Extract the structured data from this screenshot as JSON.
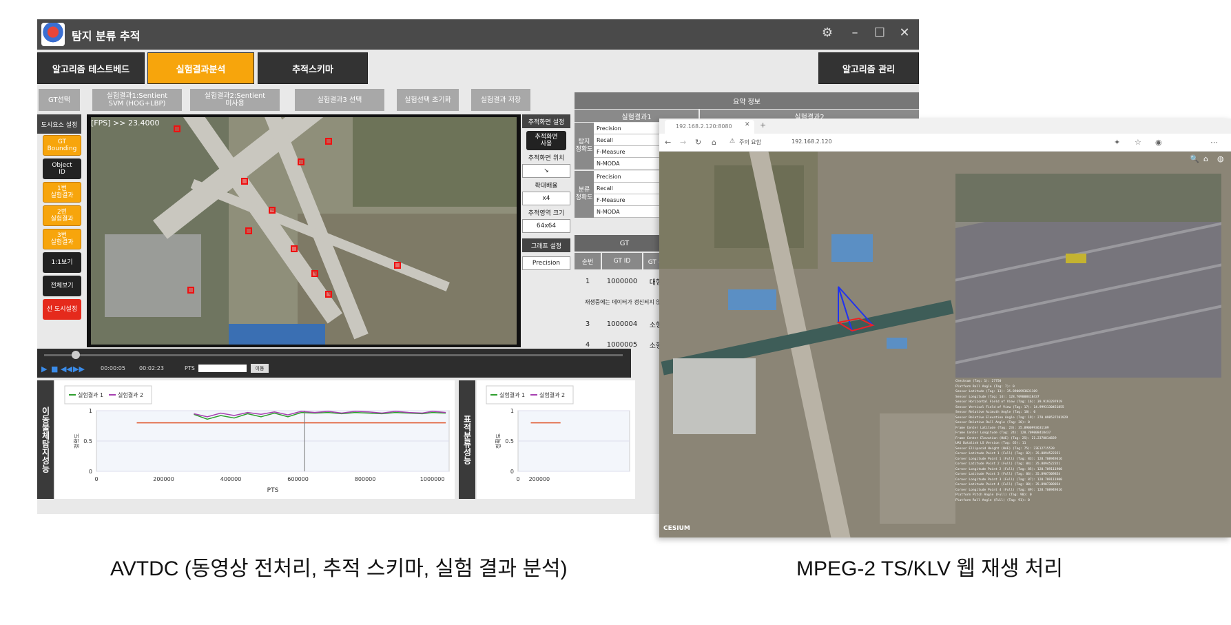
{
  "app": {
    "title": "탐지 분류 추적",
    "nav": {
      "testbed": "알고리즘 테스트베드",
      "analysis": "실험결과분석",
      "schema": "추적스키마",
      "manage": "알고리즘 관리"
    },
    "toolbar": {
      "gt_select": "GT선택",
      "result1": "실험결과1:Sentient\nSVM (HOG+LBP)",
      "result2": "실험결과2:Sentient\n미사용",
      "result3": "실험결과3 선택",
      "reset": "실험선택 초기화",
      "save": "실험결과 저장"
    },
    "display_settings": {
      "header": "도시요소 설정",
      "buttons": [
        "GT\nBounding",
        "Object\nID",
        "1번\n실험결과",
        "2번\n실험결과",
        "3번\n실험결과",
        "1:1보기",
        "전체보기",
        "선 도시설정"
      ]
    },
    "video": {
      "overlay": "[FPS] >> 23.4000"
    },
    "track_settings": {
      "header": "추적화면 설정",
      "use_label": "추적화면\n사용",
      "position_label": "추적화면 위치",
      "position_value": "↘",
      "zoom_label": "확대배율",
      "zoom_value": "x4",
      "area_label": "추적영역 크기",
      "area_value": "64x64",
      "graph_header": "그래프 설정",
      "graph_value": "Precision"
    },
    "summary": {
      "header": "요약 정보",
      "result1_col": "실험결과1",
      "result2_col": "실험결과2",
      "detect_group": "탐지\n정확도",
      "classify_group": "분류\n정확도",
      "metrics": [
        "Precision",
        "Recall",
        "F-Measure",
        "N-MODA"
      ]
    },
    "gt_table": {
      "header": "GT",
      "columns": [
        "순번",
        "GT ID",
        "GT 분류"
      ],
      "rows": [
        {
          "idx": "1",
          "id": "1000000",
          "cls": "대형차"
        },
        {
          "idx": "재생중에는 데이터가 갱신되지 않음",
          "id": "",
          "cls": ""
        },
        {
          "idx": "3",
          "id": "1000004",
          "cls": "소형차"
        },
        {
          "idx": "4",
          "id": "1000005",
          "cls": "소형차"
        }
      ]
    },
    "timeline": {
      "elapsed": "00:00:05",
      "total": "00:02:23",
      "pts_label": "PTS",
      "move_button": "이동"
    },
    "chart_labels": {
      "left": "이동물체탐지성능",
      "right": "표적분류성능"
    }
  },
  "chart_data": [
    {
      "type": "line",
      "xlabel": "PTS",
      "ylabel": "정확도",
      "xlim": [
        0,
        1050000
      ],
      "ylim": [
        0,
        1
      ],
      "xticks": [
        "0",
        "200000",
        "400000",
        "600000",
        "800000",
        "1000000"
      ],
      "yticks": [
        "0",
        "0.5",
        "1"
      ],
      "legend_position": "top-left",
      "grid": true,
      "x": [
        120000,
        290000,
        330000,
        370000,
        410000,
        450000,
        490000,
        530000,
        570000,
        610000,
        650000,
        690000,
        730000,
        770000,
        810000,
        850000,
        890000,
        930000,
        970000,
        1000000,
        1040000
      ],
      "series": [
        {
          "name": "실험결과 1",
          "color": "#2e9e2e",
          "values": [
            null,
            0.94,
            0.86,
            0.92,
            0.88,
            0.95,
            0.9,
            0.96,
            0.9,
            0.97,
            0.96,
            0.97,
            0.95,
            0.97,
            0.96,
            0.95,
            0.97,
            0.96,
            0.95,
            0.97,
            0.96
          ]
        },
        {
          "name": "실험결과 2",
          "color": "#a63fb0",
          "values": [
            null,
            0.95,
            0.9,
            0.96,
            0.92,
            0.97,
            0.94,
            0.98,
            0.93,
            0.99,
            0.97,
            0.99,
            0.96,
            0.99,
            0.98,
            0.96,
            0.99,
            0.97,
            0.96,
            0.99,
            0.97
          ]
        },
        {
          "name": "",
          "color": "#e0552b",
          "values": [
            0.8,
            0.8,
            0.8,
            0.8,
            0.8,
            0.8,
            0.8,
            0.8,
            0.8,
            0.8,
            0.8,
            0.8,
            0.8,
            0.8,
            0.8,
            0.8,
            0.8,
            0.8,
            0.8,
            0.8,
            0.8
          ]
        }
      ],
      "marker_x": 620000
    },
    {
      "type": "line",
      "ylabel": "정확도",
      "xlim": [
        0,
        1050000
      ],
      "ylim": [
        0,
        1
      ],
      "xticks": [
        "0",
        "200000"
      ],
      "yticks": [
        "0",
        "0.5",
        "1"
      ],
      "legend_position": "top-left",
      "grid": true,
      "x": [
        120000,
        400000
      ],
      "series": [
        {
          "name": "실험결과 1",
          "color": "#2e9e2e",
          "values": []
        },
        {
          "name": "실험결과 2",
          "color": "#a63fb0",
          "values": []
        },
        {
          "name": "",
          "color": "#e0552b",
          "values": [
            0.8,
            0.8
          ]
        }
      ]
    }
  ],
  "browser": {
    "tab_title": "192.168.2.120:8080",
    "security": "주의 요함",
    "url": "192.168.2.120",
    "map_attribution": "CESIUM",
    "telemetry": [
      "Checksum (Tag: 1): 27750",
      "Platform Roll Angle (Tag: 7): 0",
      "Sensor Latitude (Tag: 13): 35.8900993631109",
      "Sensor Longitude (Tag: 14): 128.709008418437",
      "Sensor Horizontal Field of View (Tag: 16): 39.9193297919",
      "Sensor Vertical Field of View (Tag: 17): 14.9993130451855",
      "Sensor Relative Azimuth Angle (Tag: 18): 0",
      "Sensor Relative Elevation Angle (Tag: 19): 270.098537281929",
      "Sensor Relative Roll Angle (Tag: 20): 0",
      "Frame Center Latitude (Tag: 23): 35.8900993631109",
      "Frame Center Longitude (Tag: 24): 128.709008418437",
      "Frame Center Elevation (HAE) (Tag: 25): 21.2378814839",
      "UAS Datalink LS Version (Tag: 65): 11",
      "Sensor Ellipsoid Height (HAE) (Tag: 75): 23E12715539",
      "Corner Latitude Point 1 (Full) (Tag: 82): 35.8894522351",
      "Corner Longitude Point 1 (Full) (Tag: 83): 128.708949416",
      "Corner Latitude Point 2 (Full) (Tag: 84): 35.8894522351",
      "Corner Longitude Point 2 (Full) (Tag: 85): 128.709111900",
      "Corner Latitude Point 3 (Full) (Tag: 86): 35.8907309854",
      "Corner Longitude Point 3 (Full) (Tag: 87): 128.709111900",
      "Corner Latitude Point 4 (Full) (Tag: 88): 35.8907309854",
      "Corner Longitude Point 4 (Full) (Tag: 89): 128.708949416",
      "Platform Pitch Angle (Full) (Tag: 90): 0",
      "Platform Roll Angle (Full) (Tag: 91): 0"
    ]
  },
  "captions": {
    "left": "AVTDC (동영상 전처리, 추적 스키마, 실험 결과 분석)",
    "right": "MPEG-2 TS/KLV 웹 재생 처리"
  }
}
